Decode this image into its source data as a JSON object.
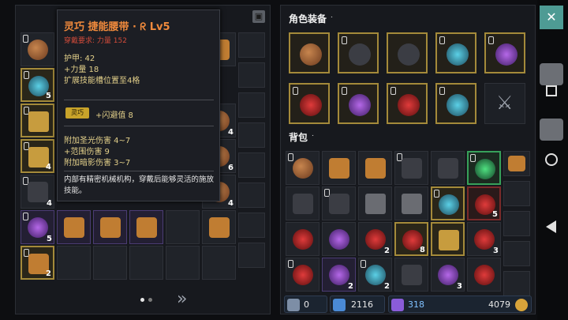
{
  "tooltip": {
    "title": "灵巧 捷能腰带 · ᖇ Lv5",
    "requirement": "穿戴要求:   力量 152",
    "stats": [
      "护甲:  42",
      "+力量 18",
      "扩展技能槽位置至4格"
    ],
    "badge": "灵巧",
    "dodge": "+闪避值 8",
    "damage": [
      "附加圣光伤害 4~7",
      "+范围伤害 9",
      "附加暗影伤害 3~7"
    ],
    "description": "内部有精密机械机构，穿戴后能够灵活的施放技能。"
  },
  "equipment": {
    "title": "角色装备",
    "arrow": "˙"
  },
  "backpack": {
    "title": "背包",
    "arrow": "˙"
  },
  "stash_counts": {
    "a": "5",
    "b": "4",
    "c": "4",
    "d": "5",
    "e": "2",
    "f": "4",
    "g": "6",
    "h": "4"
  },
  "backpack_counts": {
    "a": "5",
    "b": "2",
    "c": "8",
    "d": "3",
    "e": "2",
    "f": "2",
    "g": "3"
  },
  "stats_bar": {
    "first": "0",
    "second": "2116",
    "gems": "318",
    "gold": "4079"
  },
  "colors": {
    "accent": "#a48a3a",
    "title": "#f08a3c",
    "teal": "#4e9b94"
  }
}
